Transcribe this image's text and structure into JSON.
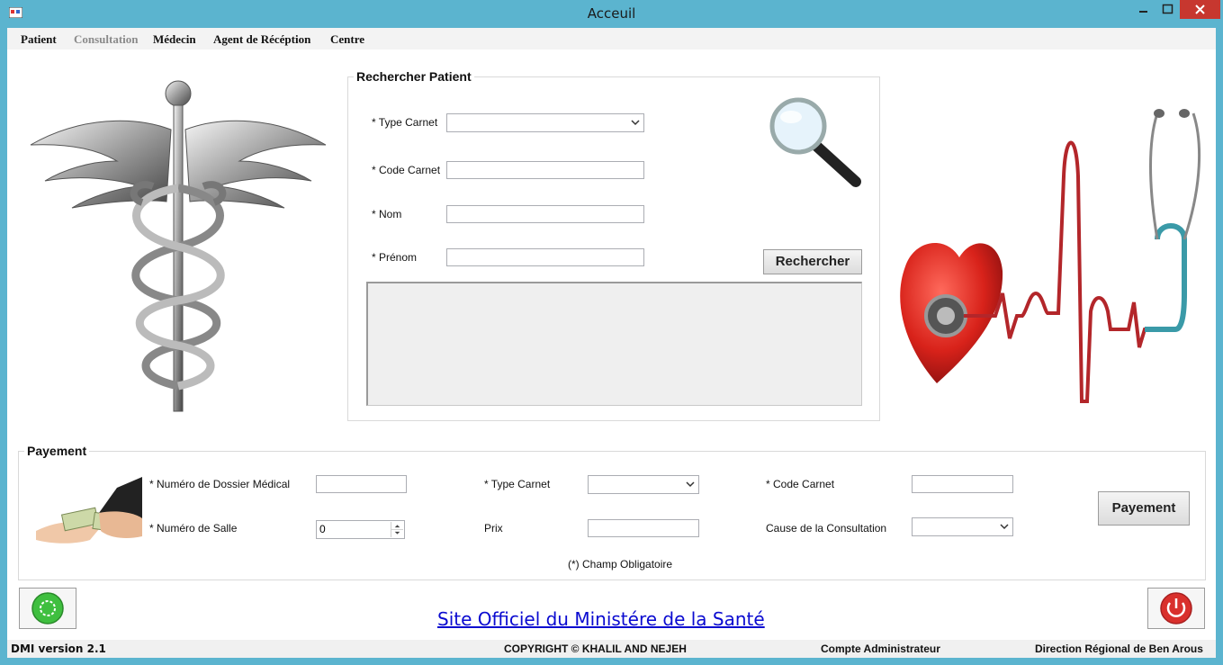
{
  "window": {
    "title": "Acceuil"
  },
  "menu": [
    {
      "label": "Patient",
      "enabled": true
    },
    {
      "label": "Consultation",
      "enabled": false
    },
    {
      "label": "Médecin",
      "enabled": true
    },
    {
      "label": "Agent de Récéption",
      "enabled": true
    },
    {
      "label": "Centre",
      "enabled": true
    }
  ],
  "search": {
    "title": "Rechercher Patient",
    "type_carnet_label": "* Type Carnet",
    "type_carnet_value": "",
    "code_carnet_label": "* Code Carnet",
    "code_carnet_value": "",
    "nom_label": "* Nom",
    "nom_value": "",
    "prenom_label": "* Prénom",
    "prenom_value": "",
    "button_label": "Rechercher"
  },
  "payment": {
    "title": "Payement",
    "dossier_label": "* Numéro de Dossier Médical",
    "dossier_value": "",
    "salle_label": "* Numéro de Salle",
    "salle_value": "0",
    "type_carnet_label": "* Type Carnet",
    "prix_label": "Prix",
    "prix_value": "",
    "code_carnet_label": "* Code Carnet",
    "code_carnet_value": "",
    "cause_label": "Cause de la Consultation",
    "note": "(*) Champ Obligatoire",
    "button_label": "Payement"
  },
  "link": {
    "text": "Site Officiel du Ministére de la Santé"
  },
  "status": {
    "version": "DMI version 2.1",
    "copyright": "COPYRIGHT © KHALIL AND NEJEH",
    "account": "Compte Administrateur",
    "region": "Direction Régional de Ben Arous"
  },
  "icons": {
    "caduceus": "caduceus-icon",
    "search": "magnifier-icon",
    "heart": "heart-stethoscope-icon",
    "money": "money-handover-icon",
    "refresh": "green-refresh-icon",
    "power": "power-icon"
  },
  "colors": {
    "titlebar": "#5bb4cf",
    "close": "#c7372f",
    "link": "#0a0ad0",
    "power": "#d9302c",
    "refresh": "#3fbf3f"
  }
}
